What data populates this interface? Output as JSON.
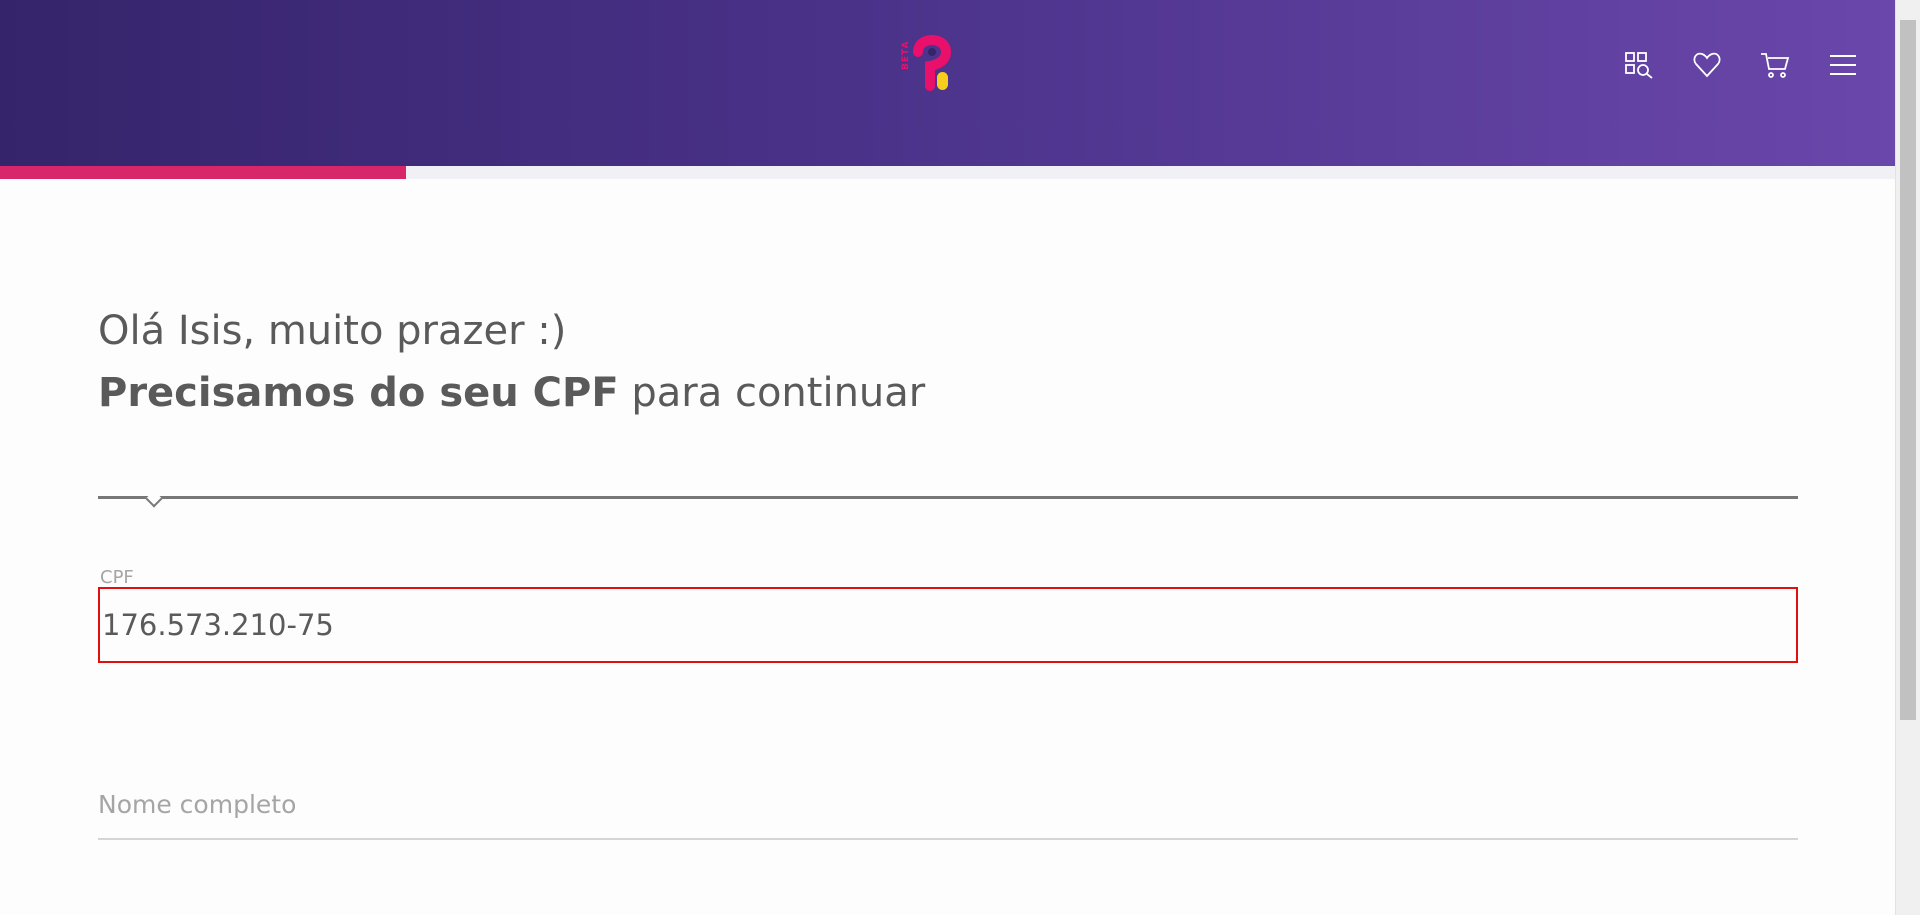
{
  "header": {
    "logo_badge": "BETA",
    "brand_colors": {
      "pink": "#e8106b",
      "yellow": "#f6cf1c",
      "gradient_start": "#35246b",
      "gradient_end": "#6a47ab"
    },
    "icons": [
      "category-search-icon",
      "heart-icon",
      "cart-icon",
      "menu-icon"
    ]
  },
  "progress": {
    "fraction": 0.214,
    "color": "#d8266a"
  },
  "greeting": {
    "line1": "Olá Isis, muito prazer :)",
    "line2_bold": "Precisamos do seu CPF",
    "line2_rest": " para continuar"
  },
  "form": {
    "cpf_label": "CPF",
    "cpf_value": "176.573.210-75",
    "cpf_error_color": "#e01010",
    "name_placeholder": "Nome completo"
  }
}
